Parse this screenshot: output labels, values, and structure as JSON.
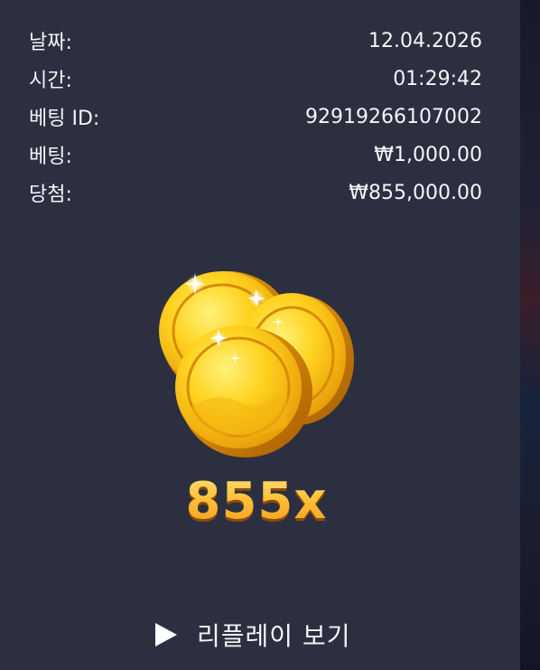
{
  "details": {
    "date_label": "날짜:",
    "date_value": "12.04.2026",
    "time_label": "시간:",
    "time_value": "01:29:42",
    "bet_id_label": "베팅 ID:",
    "bet_id_value": "92919266107002",
    "bet_label": "베팅:",
    "bet_value": "₩1,000.00",
    "win_label": "당첨:",
    "win_value": "₩855,000.00"
  },
  "result": {
    "multiplier": "855x",
    "icon": "gold-coins-icon"
  },
  "replay": {
    "label": "리플레이 보기",
    "icon": "play-icon"
  },
  "colors": {
    "background": "#2c2f3f",
    "text": "#f4f5f8",
    "multiplier": "#f7b52a"
  }
}
